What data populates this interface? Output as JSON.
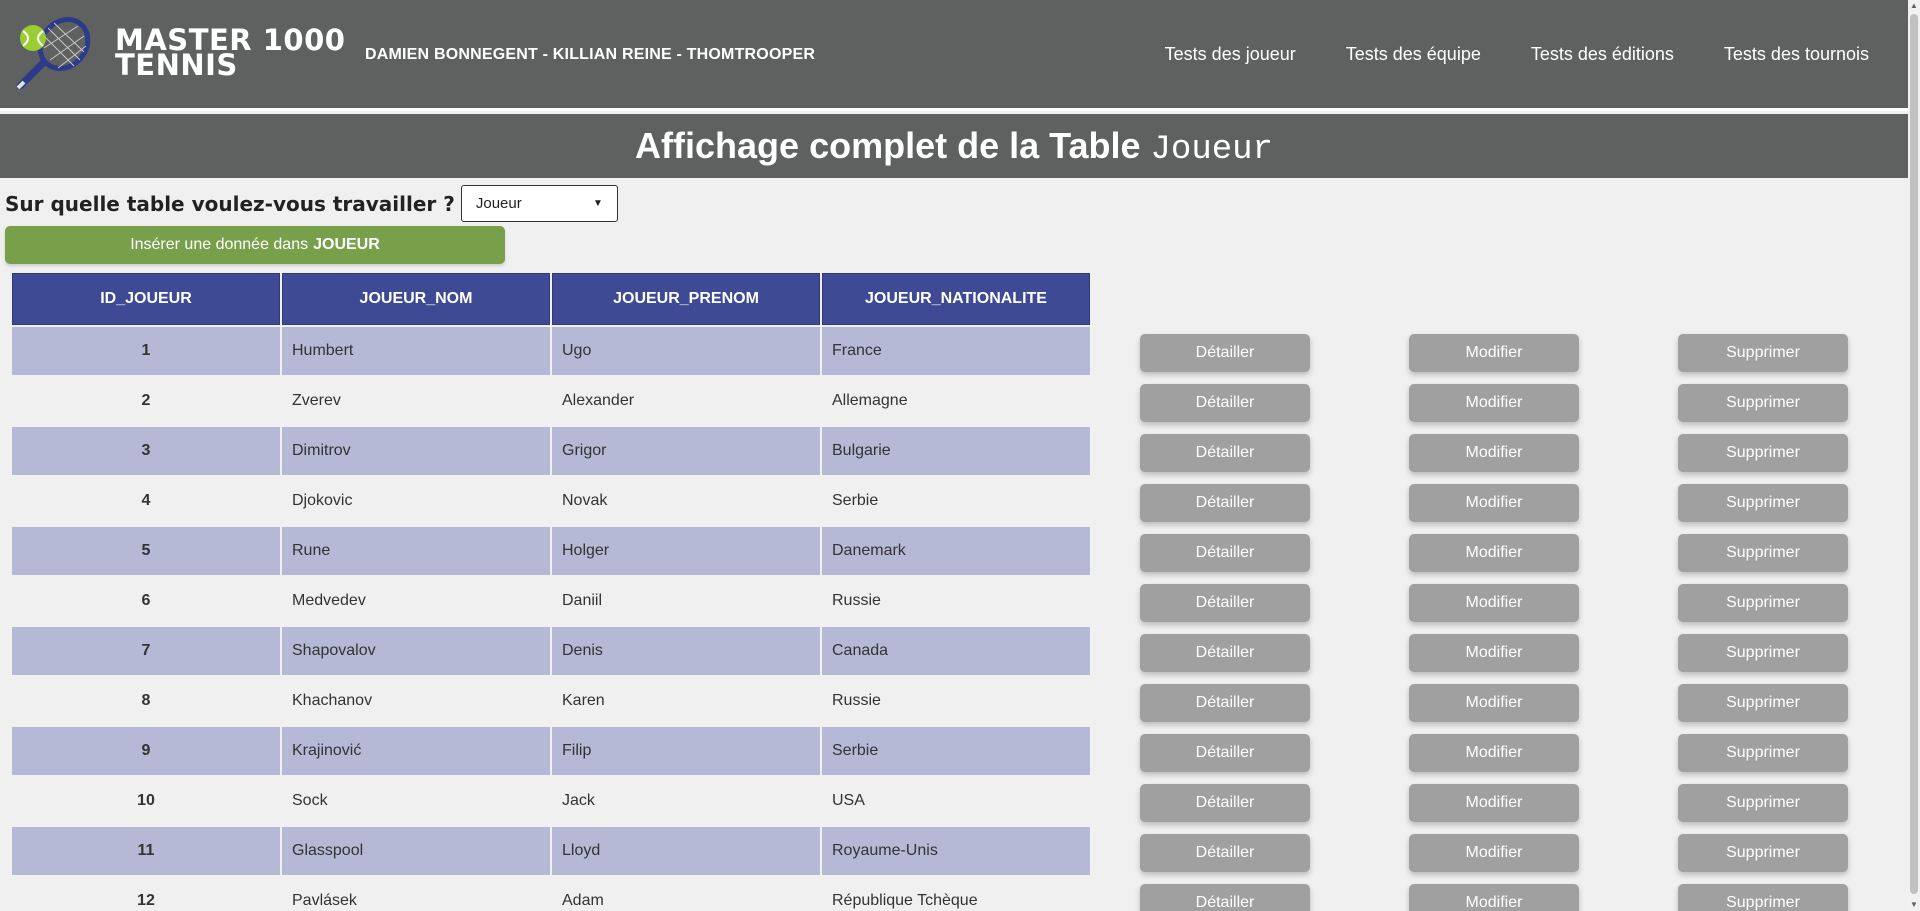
{
  "header": {
    "brand_line1": "MASTER 1000",
    "brand_line2": "TENNIS",
    "authors": "DAMIEN BONNEGENT - KILLIAN REINE - THOMTROOPER",
    "nav": [
      {
        "label": "Tests des joueur"
      },
      {
        "label": "Tests des équipe"
      },
      {
        "label": "Tests des éditions"
      },
      {
        "label": "Tests des tournois"
      }
    ]
  },
  "title": {
    "prefix": "Affichage complet de la Table",
    "table_name": "Joueur"
  },
  "selector": {
    "label": "Sur quelle table voulez-vous travailler ?",
    "value": "Joueur"
  },
  "insert": {
    "prefix": "Insérer une donnée dans",
    "table": "JOUEUR"
  },
  "table": {
    "columns": [
      "ID_JOUEUR",
      "JOUEUR_NOM",
      "JOUEUR_PRENOM",
      "JOUEUR_NATIONALITE"
    ],
    "rows": [
      [
        "1",
        "Humbert",
        "Ugo",
        "France"
      ],
      [
        "2",
        "Zverev",
        "Alexander",
        "Allemagne"
      ],
      [
        "3",
        "Dimitrov",
        "Grigor",
        "Bulgarie"
      ],
      [
        "4",
        "Djokovic",
        "Novak",
        "Serbie"
      ],
      [
        "5",
        "Rune",
        "Holger",
        "Danemark"
      ],
      [
        "6",
        "Medvedev",
        "Daniil",
        "Russie"
      ],
      [
        "7",
        "Shapovalov",
        "Denis",
        "Canada"
      ],
      [
        "8",
        "Khachanov",
        "Karen",
        "Russie"
      ],
      [
        "9",
        "Krajinović",
        "Filip",
        "Serbie"
      ],
      [
        "10",
        "Sock",
        "Jack",
        "USA"
      ],
      [
        "11",
        "Glasspool",
        "Lloyd",
        "Royaume-Unis"
      ],
      [
        "12",
        "Pavlásek",
        "Adam",
        "République Tchèque"
      ]
    ]
  },
  "actions": {
    "detail": "Détailler",
    "modify": "Modifier",
    "delete": "Supprimer"
  },
  "colors": {
    "header_bg": "#5f6160",
    "table_header_bg": "#3e4a93",
    "row_stripe": "#b5b9d6",
    "insert_button": "#78a04a",
    "action_button": "#a0a0a0"
  },
  "icons": {
    "logo": "tennis-racket-ball-icon",
    "select_arrow": "chevron-down-icon"
  }
}
